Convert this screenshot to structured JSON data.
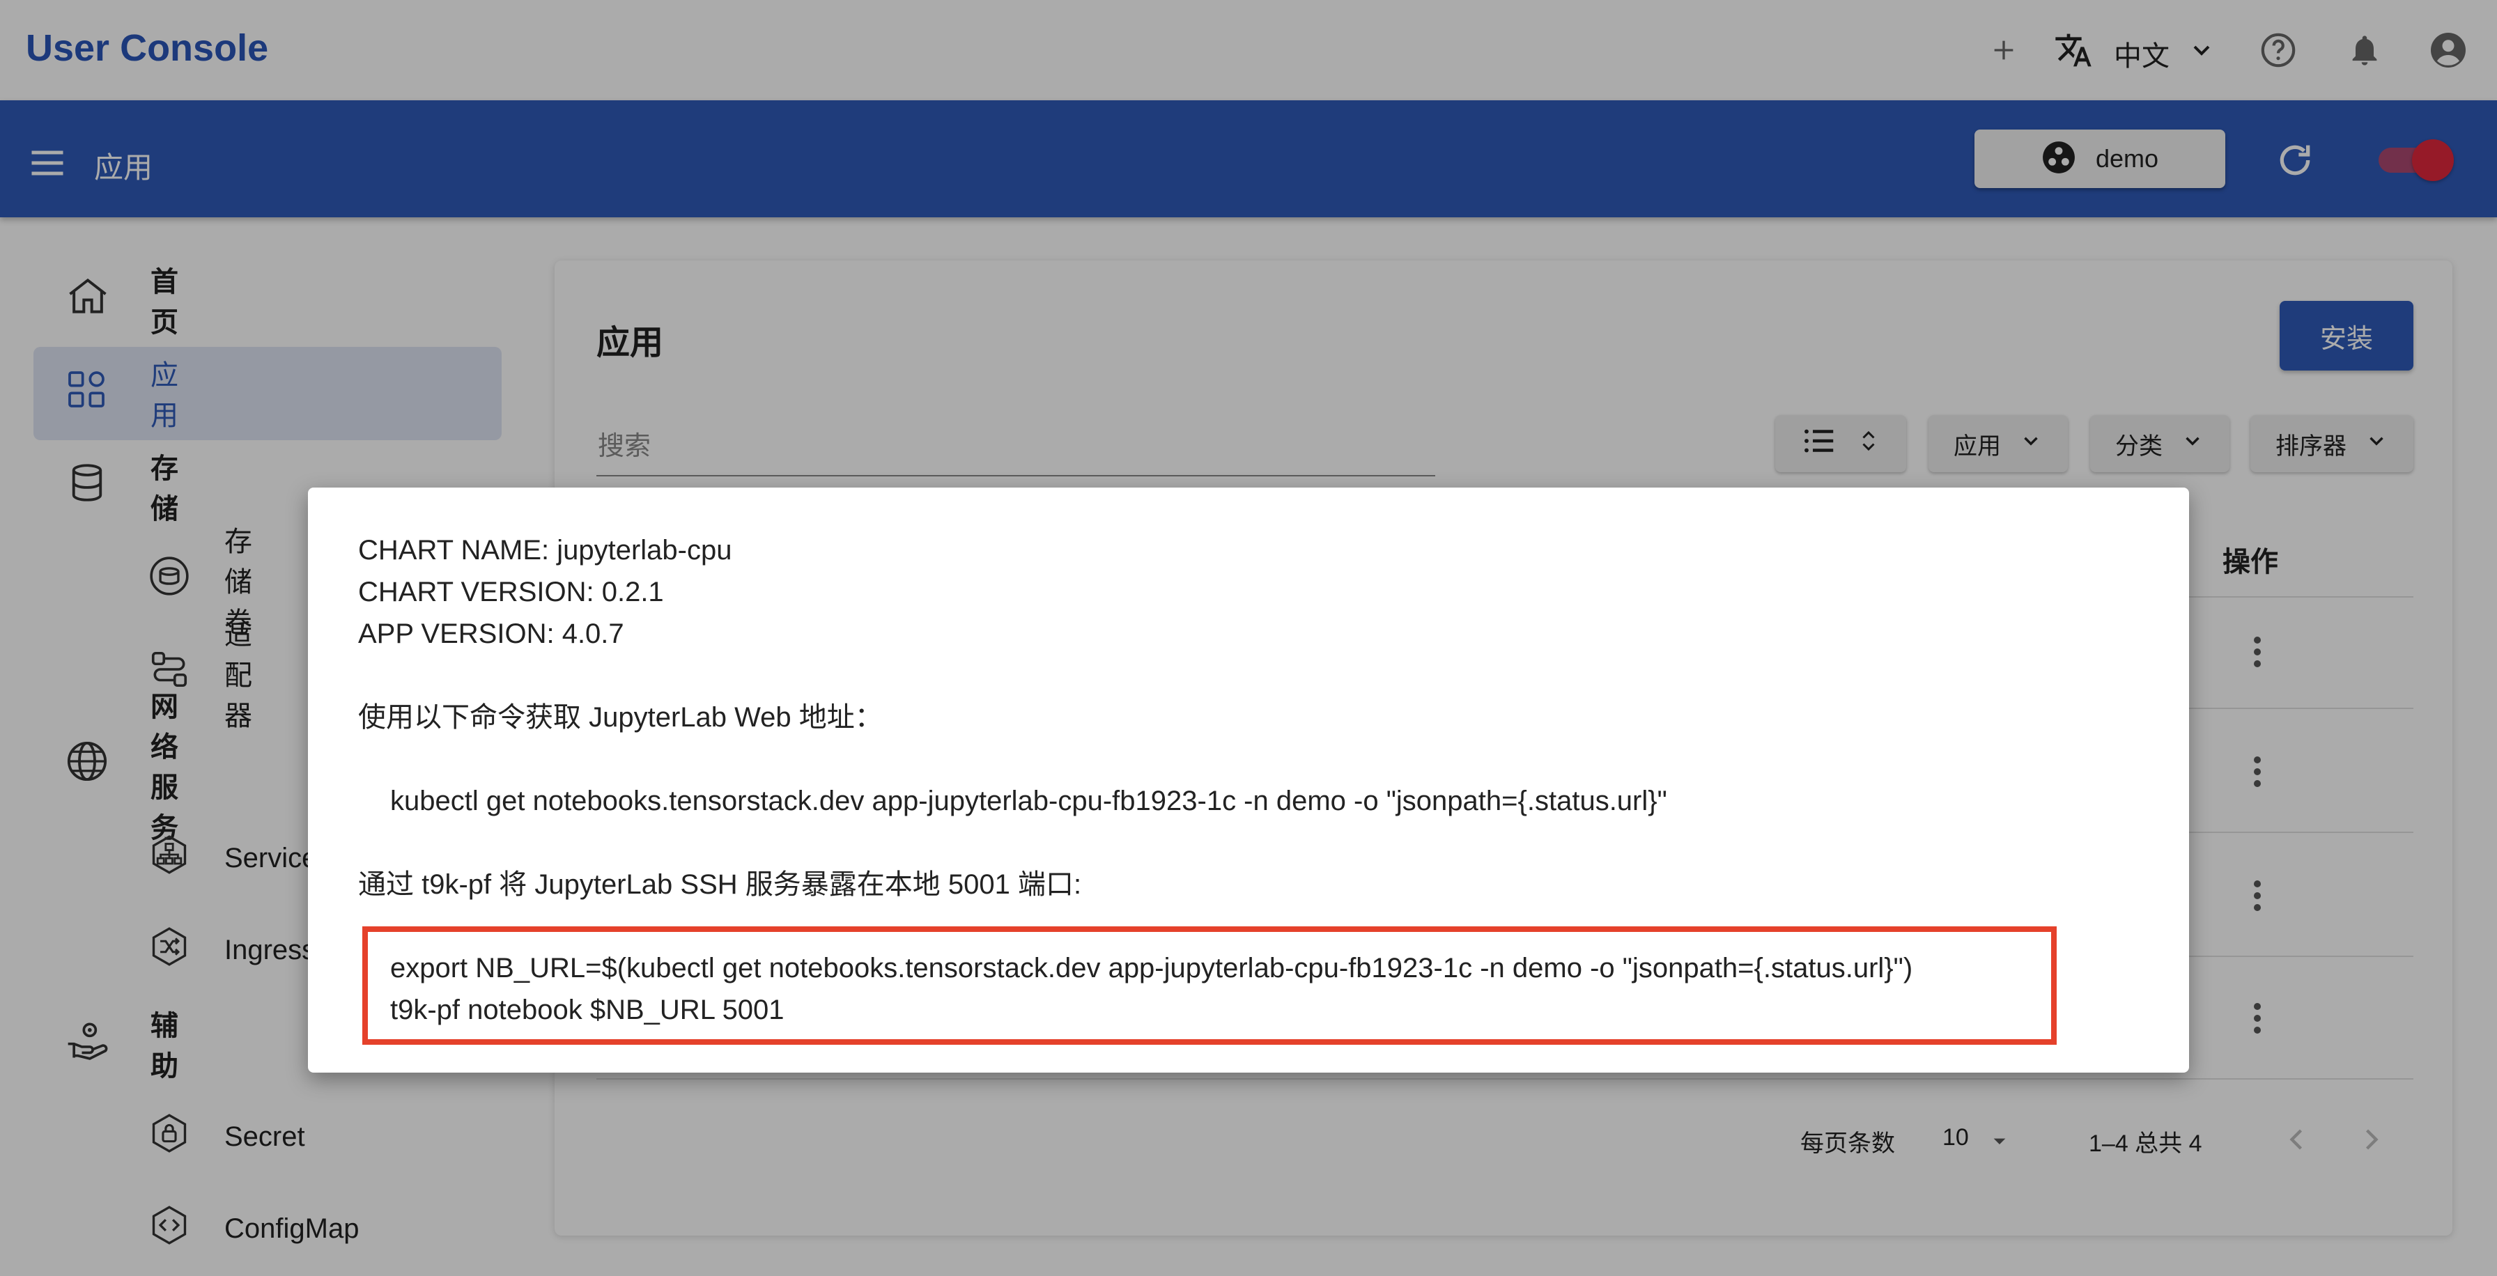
{
  "app": {
    "title": "User Console"
  },
  "topbar": {
    "lang_label": "中文",
    "icons": [
      "plus-icon",
      "translate-icon",
      "chevron-down-icon",
      "help-icon",
      "bell-icon",
      "account-icon"
    ]
  },
  "appbar": {
    "title": "应用",
    "namespace": "demo"
  },
  "sidebar": {
    "items": [
      {
        "label": "首页",
        "icon": "home-icon"
      },
      {
        "label": "应用",
        "icon": "apps-icon",
        "active": true
      },
      {
        "label": "存储",
        "icon": "database-icon"
      },
      {
        "label": "存储卷",
        "icon": "disk-icon",
        "sub": true
      },
      {
        "label": "适配器",
        "icon": "route-icon",
        "sub": true
      },
      {
        "label": "网络服务",
        "icon": "globe-icon"
      },
      {
        "label": "Service",
        "icon": "network-icon",
        "sub": true
      },
      {
        "label": "Ingress",
        "icon": "shuffle-icon",
        "sub": true
      },
      {
        "label": "辅助",
        "icon": "hand-gear-icon"
      },
      {
        "label": "Secret",
        "icon": "lock-icon",
        "sub": true
      },
      {
        "label": "ConfigMap",
        "icon": "code-icon",
        "sub": true
      }
    ]
  },
  "main": {
    "title": "应用",
    "install_label": "安装",
    "search_placeholder": "搜索",
    "filters": [
      {
        "label": "应用"
      },
      {
        "label": "分类"
      },
      {
        "label": "排序器"
      }
    ],
    "column_actions": "操作",
    "row_count": 4,
    "pagination": {
      "rows_per_page_label": "每页条数",
      "rows_per_page": "10",
      "range": "1–4 总共 4"
    }
  },
  "dialog": {
    "chart_name": "CHART NAME: jupyterlab-cpu",
    "chart_version": "CHART VERSION: 0.2.1",
    "app_version": "APP VERSION: 4.0.7",
    "url_intro": "使用以下命令获取 JupyterLab Web 地址：",
    "url_cmd": "kubectl get notebooks.tensorstack.dev app-jupyterlab-cpu-fb1923-1c -n demo -o \"jsonpath={.status.url}\"",
    "ssh_intro": "通过 t9k-pf 将 JupyterLab SSH 服务暴露在本地 5001 端口:",
    "ssh_cmd_1": "export NB_URL=$(kubectl get notebooks.tensorstack.dev app-jupyterlab-cpu-fb1923-1c -n demo -o \"jsonpath={.status.url}\")",
    "ssh_cmd_2": "t9k-pf notebook $NB_URL 5001",
    "highlight_color": "#e5412b"
  },
  "colors": {
    "brand": "#2a55b8",
    "appbar": "#2f5ab8",
    "toggle": "#e0283c"
  }
}
